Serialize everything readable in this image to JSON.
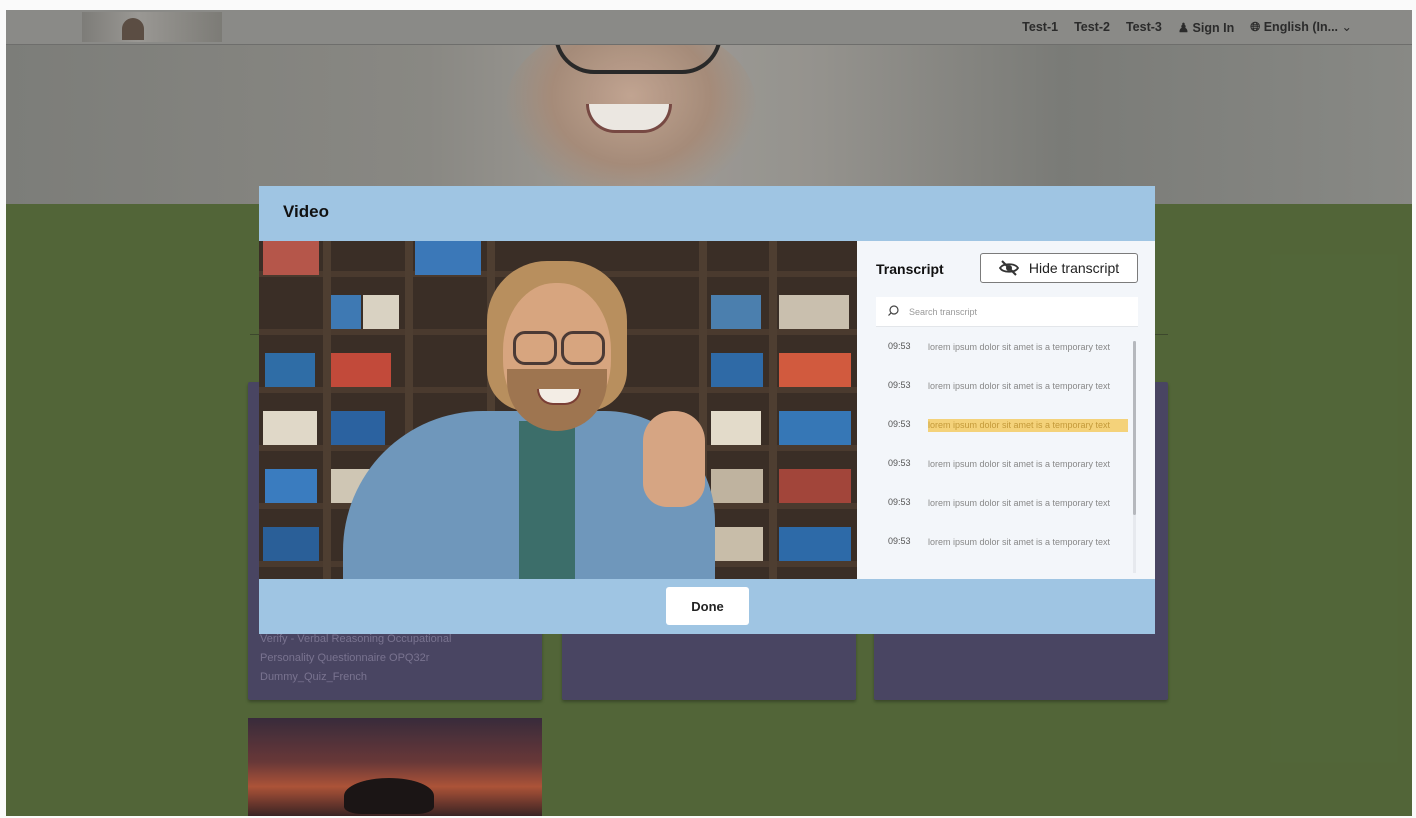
{
  "nav": {
    "links": [
      "Test-1",
      "Test-2",
      "Test-3"
    ],
    "sign_in": "Sign In",
    "language": "English (In...",
    "user_icon": "user-icon",
    "globe_icon": "globe-icon",
    "chevron_icon": "chevron-down-icon"
  },
  "background_cards": {
    "card_1_lines": [
      "Verify - Verbal Reasoning Occupational",
      "Personality Questionnaire OPQ32r",
      "Dummy_Quiz_French"
    ]
  },
  "modal": {
    "title": "Video",
    "done_label": "Done"
  },
  "transcript": {
    "title": "Transcript",
    "hide_label": "Hide transcript",
    "hide_icon": "eye-slash-icon",
    "search_placeholder": "Search transcript",
    "search_icon": "search-icon",
    "entries": [
      {
        "time": "09:53",
        "text": "lorem ipsum dolor sit amet is a temporary text",
        "highlighted": false
      },
      {
        "time": "09:53",
        "text": "lorem ipsum dolor sit amet is a temporary text",
        "highlighted": false
      },
      {
        "time": "09:53",
        "text": "lorem ipsum dolor sit amet is a temporary text",
        "highlighted": true
      },
      {
        "time": "09:53",
        "text": "lorem ipsum dolor sit amet is a temporary text",
        "highlighted": false
      },
      {
        "time": "09:53",
        "text": "lorem ipsum dolor sit amet is a temporary text",
        "highlighted": false
      },
      {
        "time": "09:53",
        "text": "lorem ipsum dolor sit amet is a temporary text",
        "highlighted": false
      }
    ]
  },
  "colors": {
    "modal_header": "#9fc5e3",
    "page_background": "#54683a",
    "card_background": "#4b4764",
    "highlight": "#f4d27a"
  }
}
